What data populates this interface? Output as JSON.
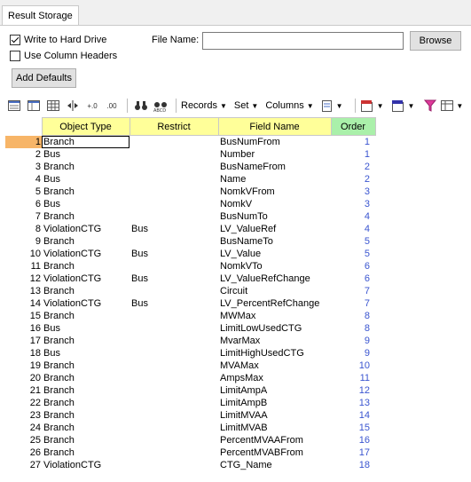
{
  "tab": {
    "label": "Result Storage"
  },
  "options": {
    "write_to_hard_drive": {
      "label": "Write to Hard Drive",
      "checked": true
    },
    "use_column_headers": {
      "label": "Use Column Headers",
      "checked": false
    },
    "file_name_label": "File Name:",
    "file_name_value": "",
    "browse_label": "Browse",
    "add_defaults_label": "Add Defaults"
  },
  "toolbar": {
    "records_label": "Records",
    "set_label": "Set",
    "columns_label": "Columns"
  },
  "table": {
    "headers": {
      "object_type": "Object Type",
      "restrict": "Restrict",
      "field_name": "Field Name",
      "order": "Order"
    },
    "rows": [
      {
        "num": "1",
        "object_type": "Branch",
        "restrict": "",
        "field_name": "BusNumFrom",
        "order": "1"
      },
      {
        "num": "2",
        "object_type": "Bus",
        "restrict": "",
        "field_name": "Number",
        "order": "1"
      },
      {
        "num": "3",
        "object_type": "Branch",
        "restrict": "",
        "field_name": "BusNameFrom",
        "order": "2"
      },
      {
        "num": "4",
        "object_type": "Bus",
        "restrict": "",
        "field_name": "Name",
        "order": "2"
      },
      {
        "num": "5",
        "object_type": "Branch",
        "restrict": "",
        "field_name": "NomkVFrom",
        "order": "3"
      },
      {
        "num": "6",
        "object_type": "Bus",
        "restrict": "",
        "field_name": "NomkV",
        "order": "3"
      },
      {
        "num": "7",
        "object_type": "Branch",
        "restrict": "",
        "field_name": "BusNumTo",
        "order": "4"
      },
      {
        "num": "8",
        "object_type": "ViolationCTG",
        "restrict": "Bus",
        "field_name": "LV_ValueRef",
        "order": "4"
      },
      {
        "num": "9",
        "object_type": "Branch",
        "restrict": "",
        "field_name": "BusNameTo",
        "order": "5"
      },
      {
        "num": "10",
        "object_type": "ViolationCTG",
        "restrict": "Bus",
        "field_name": "LV_Value",
        "order": "5"
      },
      {
        "num": "11",
        "object_type": "Branch",
        "restrict": "",
        "field_name": "NomkVTo",
        "order": "6"
      },
      {
        "num": "12",
        "object_type": "ViolationCTG",
        "restrict": "Bus",
        "field_name": "LV_ValueRefChange",
        "order": "6"
      },
      {
        "num": "13",
        "object_type": "Branch",
        "restrict": "",
        "field_name": "Circuit",
        "order": "7"
      },
      {
        "num": "14",
        "object_type": "ViolationCTG",
        "restrict": "Bus",
        "field_name": "LV_PercentRefChange",
        "order": "7"
      },
      {
        "num": "15",
        "object_type": "Branch",
        "restrict": "",
        "field_name": "MWMax",
        "order": "8"
      },
      {
        "num": "16",
        "object_type": "Bus",
        "restrict": "",
        "field_name": "LimitLowUsedCTG",
        "order": "8"
      },
      {
        "num": "17",
        "object_type": "Branch",
        "restrict": "",
        "field_name": "MvarMax",
        "order": "9"
      },
      {
        "num": "18",
        "object_type": "Bus",
        "restrict": "",
        "field_name": "LimitHighUsedCTG",
        "order": "9"
      },
      {
        "num": "19",
        "object_type": "Branch",
        "restrict": "",
        "field_name": "MVAMax",
        "order": "10"
      },
      {
        "num": "20",
        "object_type": "Branch",
        "restrict": "",
        "field_name": "AmpsMax",
        "order": "11"
      },
      {
        "num": "21",
        "object_type": "Branch",
        "restrict": "",
        "field_name": "LimitAmpA",
        "order": "12"
      },
      {
        "num": "22",
        "object_type": "Branch",
        "restrict": "",
        "field_name": "LimitAmpB",
        "order": "13"
      },
      {
        "num": "23",
        "object_type": "Branch",
        "restrict": "",
        "field_name": "LimitMVAA",
        "order": "14"
      },
      {
        "num": "24",
        "object_type": "Branch",
        "restrict": "",
        "field_name": "LimitMVAB",
        "order": "15"
      },
      {
        "num": "25",
        "object_type": "Branch",
        "restrict": "",
        "field_name": "PercentMVAAFrom",
        "order": "16"
      },
      {
        "num": "26",
        "object_type": "Branch",
        "restrict": "",
        "field_name": "PercentMVABFrom",
        "order": "17"
      },
      {
        "num": "27",
        "object_type": "ViolationCTG",
        "restrict": "",
        "field_name": "CTG_Name",
        "order": "18"
      }
    ]
  }
}
